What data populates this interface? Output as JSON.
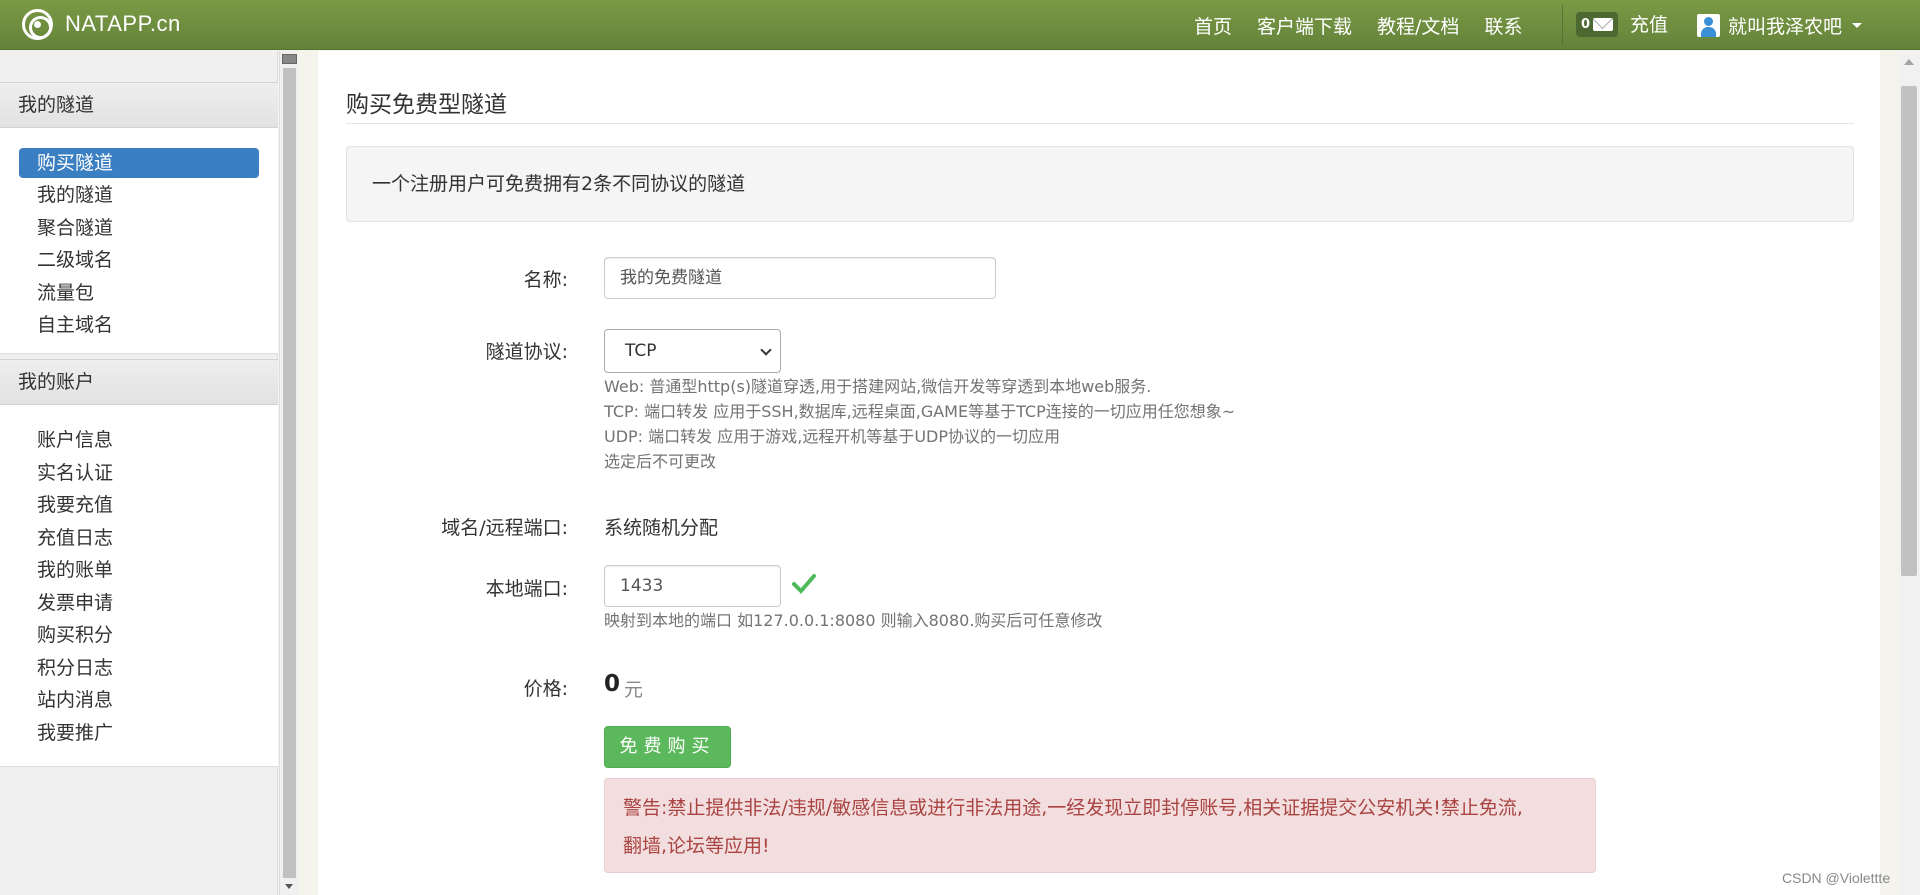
{
  "navbar": {
    "brand": "NATAPP.cn",
    "links": [
      "首页",
      "客户端下载",
      "教程/文档",
      "联系"
    ],
    "message_count": "0",
    "recharge_label": "充值",
    "username": "就叫我泽农吧"
  },
  "sidebar": {
    "section1_title": "我的隧道",
    "section1_items": [
      "购买隧道",
      "我的隧道",
      "聚合隧道",
      "二级域名",
      "流量包",
      "自主域名"
    ],
    "section2_title": "我的账户",
    "section2_items": [
      "账户信息",
      "实名认证",
      "我要充值",
      "充值日志",
      "我的账单",
      "发票申请",
      "购买积分",
      "积分日志",
      "站内消息",
      "我要推广"
    ]
  },
  "main": {
    "title": "购买免费型隧道",
    "notice": "一个注册用户可免费拥有2条不同协议的隧道",
    "form": {
      "name_label": "名称:",
      "name_value": "我的免费隧道",
      "protocol_label": "隧道协议:",
      "protocol_value": "TCP",
      "protocol_help": [
        "Web: 普通型http(s)隧道穿透,用于搭建网站,微信开发等穿透到本地web服务.",
        "TCP: 端口转发 应用于SSH,数据库,远程桌面,GAME等基于TCP连接的一切应用任您想象~",
        "UDP: 端口转发 应用于游戏,远程开机等基于UDP协议的一切应用",
        "选定后不可更改"
      ],
      "domain_label": "域名/远程端口:",
      "domain_value": "系统随机分配",
      "local_port_label": "本地端口:",
      "local_port_value": "1433",
      "local_port_help": "映射到本地的端口 如127.0.0.1:8080 则输入8080.购买后可任意修改",
      "price_label": "价格:",
      "price_value": "0",
      "price_unit": "元",
      "buy_button": "免费购买",
      "warning_line1": "警告:禁止提供非法/违规/敏感信息或进行非法用途,一经发现立即封停账号,相关证据提交公安机关!禁止免流,",
      "warning_line2": "翻墙,论坛等应用!"
    }
  },
  "watermark": "CSDN @Violettte",
  "colors": {
    "navbar": "#6e8e3c",
    "active_item": "#3a7fc1",
    "success": "#5cb85c",
    "danger_bg": "#f2dede",
    "danger_text": "#a94442"
  }
}
